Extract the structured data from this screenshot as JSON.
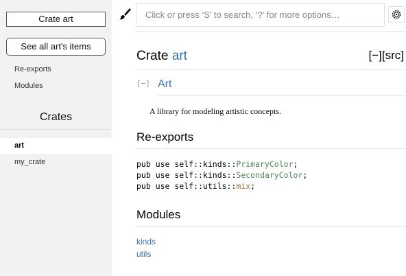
{
  "sidebar": {
    "crate_title": "Crate art",
    "all_items_label": "See all art's items",
    "links": [
      "Re-exports",
      "Modules"
    ],
    "crates_heading": "Crates",
    "crates": [
      "art",
      "my_crate"
    ]
  },
  "topbar": {
    "brush_icon": "paintbrush-icon",
    "search_placeholder": "Click or press ‘S’ to search, ‘?’ for more options…",
    "settings_icon": "gear-icon"
  },
  "main": {
    "title_prefix": "Crate ",
    "title_name": "art",
    "collapse_all": "[−]",
    "src": "[src]",
    "toggle": "[−]",
    "doc_heading": "Art",
    "description": "A library for modeling artistic concepts.",
    "reexports_heading": "Re-exports",
    "reexports": [
      {
        "prefix": "pub use self::kinds::",
        "item": "PrimaryColor",
        "kind": "enum"
      },
      {
        "prefix": "pub use self::kinds::",
        "item": "SecondaryColor",
        "kind": "enum"
      },
      {
        "prefix": "pub use self::utils::",
        "item": "mix",
        "kind": "fn"
      }
    ],
    "modules_heading": "Modules",
    "modules": [
      "kinds",
      "utils"
    ]
  },
  "colors": {
    "link": "#3873ad",
    "enum": "#508157",
    "fn": "#9a6e31",
    "sidebar_bg": "#f2f2f2"
  }
}
